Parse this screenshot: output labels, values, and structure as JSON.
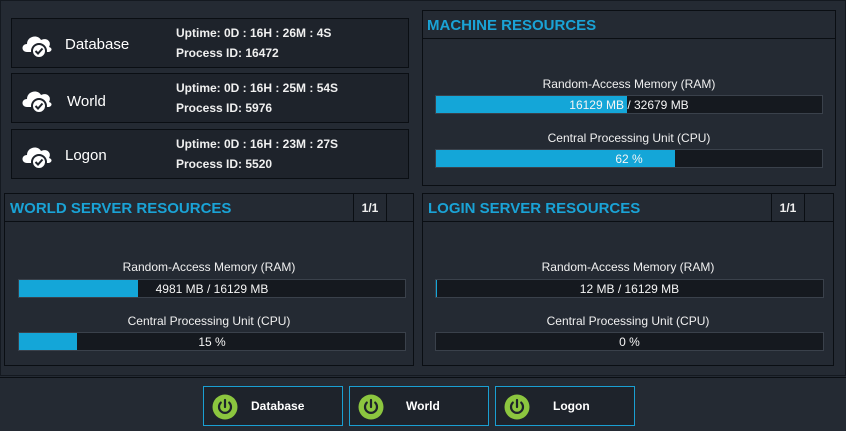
{
  "servers": [
    {
      "name": "Database",
      "uptime": "Uptime: 0D : 16H : 26M : 4S",
      "pid": "Process ID: 16472",
      "icon": "cloud-check-icon"
    },
    {
      "name": "World",
      "uptime": "Uptime: 0D : 16H : 25M : 54S",
      "pid": "Process ID: 5976",
      "icon": "cloud-check-icon"
    },
    {
      "name": "Logon",
      "uptime": "Uptime: 0D : 16H : 23M : 27S",
      "pid": "Process ID: 5520",
      "icon": "cloud-check-icon"
    }
  ],
  "machine": {
    "title": "MACHINE RESOURCES",
    "ram_label": "Random-Access Memory  (RAM)",
    "ram_text": "16129 MB / 32679 MB",
    "ram_fraction": 0.4936,
    "cpu_label": "Central Processing Unit (CPU)",
    "cpu_text": "62 %",
    "cpu_fraction": 0.62
  },
  "world_res": {
    "title": "WORLD SERVER RESOURCES",
    "pager": "1/1",
    "ram_label": "Random-Access Memory  (RAM)",
    "ram_text": "4981 MB / 16129 MB",
    "ram_fraction": 0.3088,
    "cpu_label": "Central Processing Unit (CPU)",
    "cpu_text": "15 %",
    "cpu_fraction": 0.15
  },
  "login_res": {
    "title": "LOGIN SERVER RESOURCES",
    "pager": "1/1",
    "ram_label": "Random-Access Memory  (RAM)",
    "ram_text": "12 MB / 16129 MB",
    "ram_fraction": 0.0007,
    "cpu_label": "Central Processing Unit (CPU)",
    "cpu_text": "0 %",
    "cpu_fraction": 0.0
  },
  "controls": [
    {
      "label": "Database",
      "icon": "power-icon"
    },
    {
      "label": "World",
      "icon": "power-icon"
    },
    {
      "label": "Logon",
      "icon": "power-icon"
    }
  ],
  "colors": {
    "accent": "#14a6d8",
    "power": "#8cc63f",
    "title": "#1aa3d6"
  }
}
